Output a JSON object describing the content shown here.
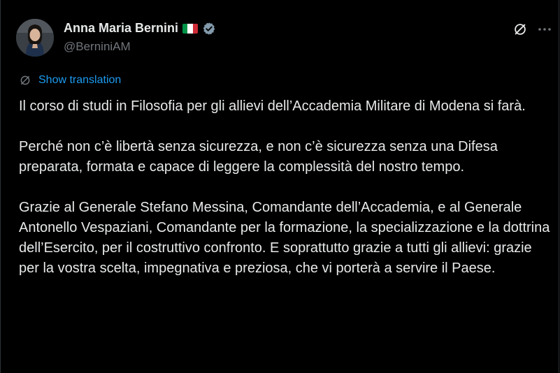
{
  "author": {
    "display_name": "Anna Maria Bernini",
    "handle": "@BerniniAM",
    "flag_colors": [
      "#009246",
      "#ffffff",
      "#ce2b37"
    ],
    "verified_badge_color": "#829aab",
    "flag_icon": "italy-flag-icon",
    "avatar_icon": "profile-photo"
  },
  "actions": {
    "grok_icon": "slashed-circle-icon",
    "more_icon": "more-dots-icon"
  },
  "translation": {
    "label": "Show translation",
    "icon": "slashed-circle-icon",
    "color": "#1d9bf0"
  },
  "tweet": {
    "paragraphs": [
      "Il corso di studi in Filosofia per gli allievi dell’Accademia Militare di Modena si farà.",
      "Perché non c’è libertà senza sicurezza, e non c’è sicurezza senza una Difesa preparata, formata e capace di leggere la complessità del nostro tempo.",
      "Grazie al Generale Stefano Messina, Comandante dell’Accademia, e al Generale Antonello Vespaziani, Comandante per la formazione, la specializzazione e la dottrina dell’Esercito, per il costruttivo confronto. E soprattutto grazie a tutti gli allievi: grazie per la vostra scelta, impegnativa e preziosa, che vi porterà a servire il Paese."
    ]
  }
}
